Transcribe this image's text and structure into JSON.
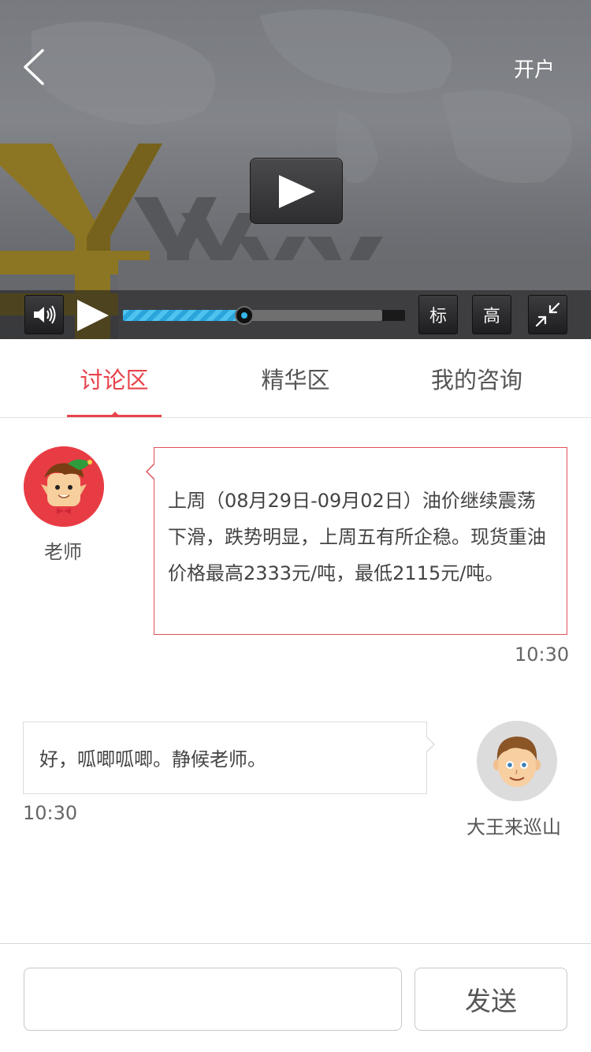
{
  "header": {
    "back_icon": "chevron-left-icon",
    "open_account_label": "开户"
  },
  "player": {
    "center_play_icon": "play-icon",
    "volume_icon": "volume-icon",
    "play_icon": "play-icon",
    "played_fraction": 0.43,
    "buffered_fraction": 0.92,
    "standard_label": "标",
    "high_label": "高",
    "fullscreen_exit_icon": "exit-fullscreen-icon",
    "accent_color": "#35b5ea"
  },
  "tabs": [
    {
      "label": "讨论区",
      "active": true
    },
    {
      "label": "精华区",
      "active": false
    },
    {
      "label": "我的咨询",
      "active": false
    }
  ],
  "messages": [
    {
      "sender": "老师",
      "text": "上周（08月29日-09月02日）油价继续震荡下滑，跌势明显，上周五有所企稳。现货重油价格最高2333元/吨，最低2115元/吨。",
      "time": "10:30",
      "side": "left"
    },
    {
      "sender": "大王来巡山",
      "text": "好，呱唧呱唧。静候老师。",
      "time": "10:30",
      "side": "right"
    }
  ],
  "composer": {
    "value": "",
    "placeholder": "",
    "send_label": "发送"
  },
  "colors": {
    "accent": "#e8434b",
    "teacher_avatar_bg": "#e83c44",
    "user_avatar_bg": "#dcdcdc"
  }
}
